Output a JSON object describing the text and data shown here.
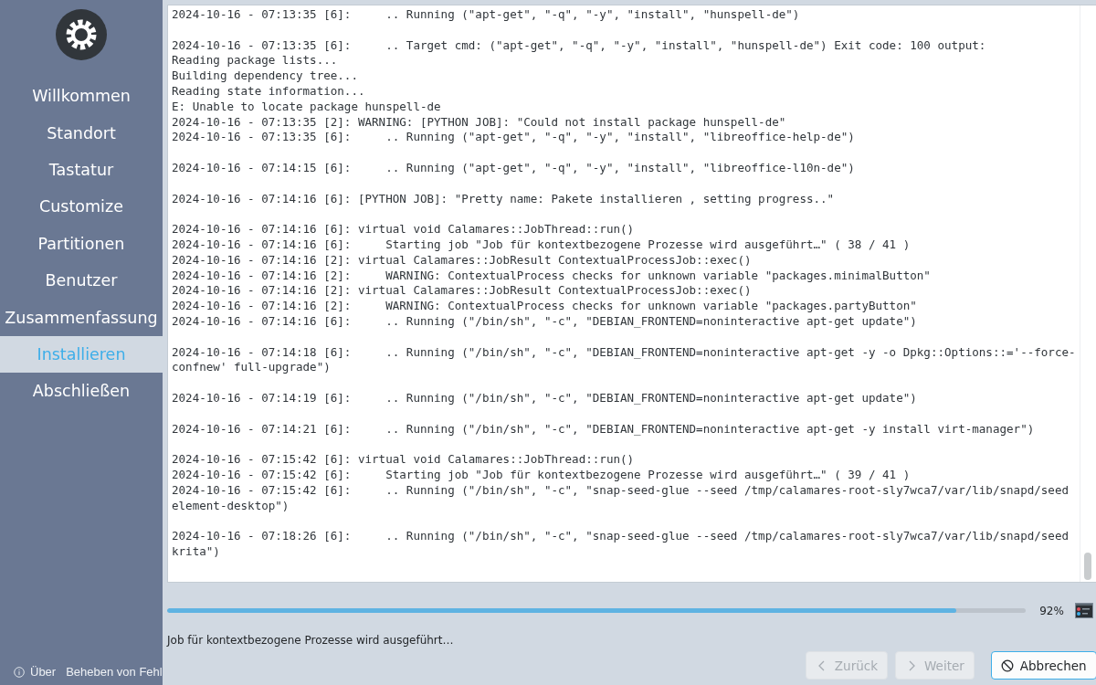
{
  "sidebar": {
    "nav_items": [
      {
        "label": "Willkommen",
        "selected": false
      },
      {
        "label": "Standort",
        "selected": false
      },
      {
        "label": "Tastatur",
        "selected": false
      },
      {
        "label": "Customize",
        "selected": false
      },
      {
        "label": "Partitionen",
        "selected": false
      },
      {
        "label": "Benutzer",
        "selected": false
      },
      {
        "label": "Zusammenfassung",
        "selected": false
      },
      {
        "label": "Installieren",
        "selected": true
      },
      {
        "label": "Abschließen",
        "selected": false
      }
    ],
    "footer_links": [
      {
        "label": "Über",
        "kind": "about"
      },
      {
        "label": "Beheben von Fehl",
        "kind": "plain"
      }
    ]
  },
  "log": [
    [
      "2024-10-16 - 07:13:35 [6]:     .. Running (\"apt-get\", \"-q\", \"-y\", \"install\", \"hunspell-de\")"
    ],
    [
      "2024-10-16 - 07:13:35 [6]:     .. Target cmd: (\"apt-get\", \"-q\", \"-y\", \"install\", \"hunspell-de\") Exit code: 100 output:",
      "Reading package lists...",
      "Building dependency tree...",
      "Reading state information...",
      "E: Unable to locate package hunspell-de",
      "2024-10-16 - 07:13:35 [2]: WARNING: [PYTHON JOB]: \"Could not install package hunspell-de\"",
      "2024-10-16 - 07:13:35 [6]:     .. Running (\"apt-get\", \"-q\", \"-y\", \"install\", \"libreoffice-help-de\")"
    ],
    [
      "2024-10-16 - 07:14:15 [6]:     .. Running (\"apt-get\", \"-q\", \"-y\", \"install\", \"libreoffice-l10n-de\")"
    ],
    [
      "2024-10-16 - 07:14:16 [6]: [PYTHON JOB]: \"Pretty name: Pakete installieren , setting progress..\""
    ],
    [
      "2024-10-16 - 07:14:16 [6]: virtual void Calamares::JobThread::run()",
      "2024-10-16 - 07:14:16 [6]:     Starting job \"Job für kontextbezogene Prozesse wird ausgeführt…\" ( 38 / 41 )",
      "2024-10-16 - 07:14:16 [2]: virtual Calamares::JobResult ContextualProcessJob::exec()",
      "2024-10-16 - 07:14:16 [2]:     WARNING: ContextualProcess checks for unknown variable \"packages.minimalButton\"",
      "2024-10-16 - 07:14:16 [2]: virtual Calamares::JobResult ContextualProcessJob::exec()",
      "2024-10-16 - 07:14:16 [2]:     WARNING: ContextualProcess checks for unknown variable \"packages.partyButton\"",
      "2024-10-16 - 07:14:16 [6]:     .. Running (\"/bin/sh\", \"-c\", \"DEBIAN_FRONTEND=noninteractive apt-get update\")"
    ],
    [
      "2024-10-16 - 07:14:18 [6]:     .. Running (\"/bin/sh\", \"-c\", \"DEBIAN_FRONTEND=noninteractive apt-get -y -o Dpkg::Options::='--force-",
      "confnew' full-upgrade\")"
    ],
    [
      "2024-10-16 - 07:14:19 [6]:     .. Running (\"/bin/sh\", \"-c\", \"DEBIAN_FRONTEND=noninteractive apt-get update\")"
    ],
    [
      "2024-10-16 - 07:14:21 [6]:     .. Running (\"/bin/sh\", \"-c\", \"DEBIAN_FRONTEND=noninteractive apt-get -y install virt-manager\")"
    ],
    [
      "2024-10-16 - 07:15:42 [6]: virtual void Calamares::JobThread::run()",
      "2024-10-16 - 07:15:42 [6]:     Starting job \"Job für kontextbezogene Prozesse wird ausgeführt…\" ( 39 / 41 )",
      "2024-10-16 - 07:15:42 [6]:     .. Running (\"/bin/sh\", \"-c\", \"snap-seed-glue --seed /tmp/calamares-root-sly7wca7/var/lib/snapd/seed",
      "element-desktop\")"
    ],
    [
      "2024-10-16 - 07:18:26 [6]:     .. Running (\"/bin/sh\", \"-c\", \"snap-seed-glue --seed /tmp/calamares-root-sly7wca7/var/lib/snapd/seed",
      "krita\")"
    ]
  ],
  "progress": {
    "level": 0.92,
    "reading": "92%"
  },
  "status_text": "Job für kontextbezogene Prozesse wird ausgeführt…",
  "buttons": [
    {
      "label": "Zurück",
      "kind": "back",
      "disabled": true
    },
    {
      "label": "Weiter",
      "kind": "next",
      "disabled": true
    },
    {
      "label": "Abbrechen",
      "kind": "cancel",
      "disabled": false
    }
  ]
}
